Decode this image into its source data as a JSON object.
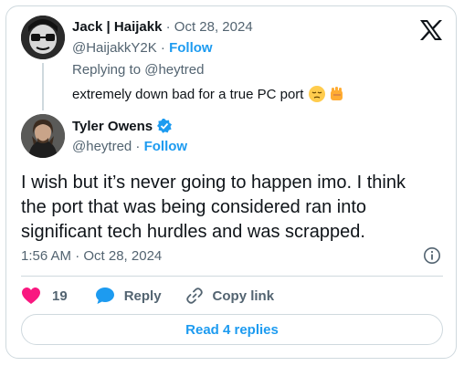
{
  "parent": {
    "name": "Jack | Haijakk",
    "date": "Oct 28, 2024",
    "handle": "@HaijakkY2K",
    "follow_label": "Follow",
    "replying_to": "Replying to @heytred",
    "text": "extremely down bad for a true PC port"
  },
  "main": {
    "name": "Tyler Owens",
    "handle": "@heytred",
    "follow_label": "Follow",
    "text_line1": "I wish but it’s never going to happen imo. I think",
    "text_line2": "the port that was being considered ran into",
    "text_line3": "significant tech hurdles and was scrapped.",
    "timestamp": "1:56 AM · Oct 28, 2024"
  },
  "actions": {
    "like_count": "19",
    "reply_label": "Reply",
    "copy_label": "Copy link"
  },
  "read_replies": "Read 4 replies",
  "colors": {
    "accent": "#1d9bf0",
    "like": "#f91880",
    "verified": "#1d9bf0",
    "muted": "#536471"
  },
  "icons": [
    "x-logo-icon",
    "verified-badge-icon",
    "info-icon",
    "heart-icon",
    "reply-bubble-icon",
    "link-icon",
    "pensive-face-emoji",
    "flexed-hand-emoji"
  ]
}
